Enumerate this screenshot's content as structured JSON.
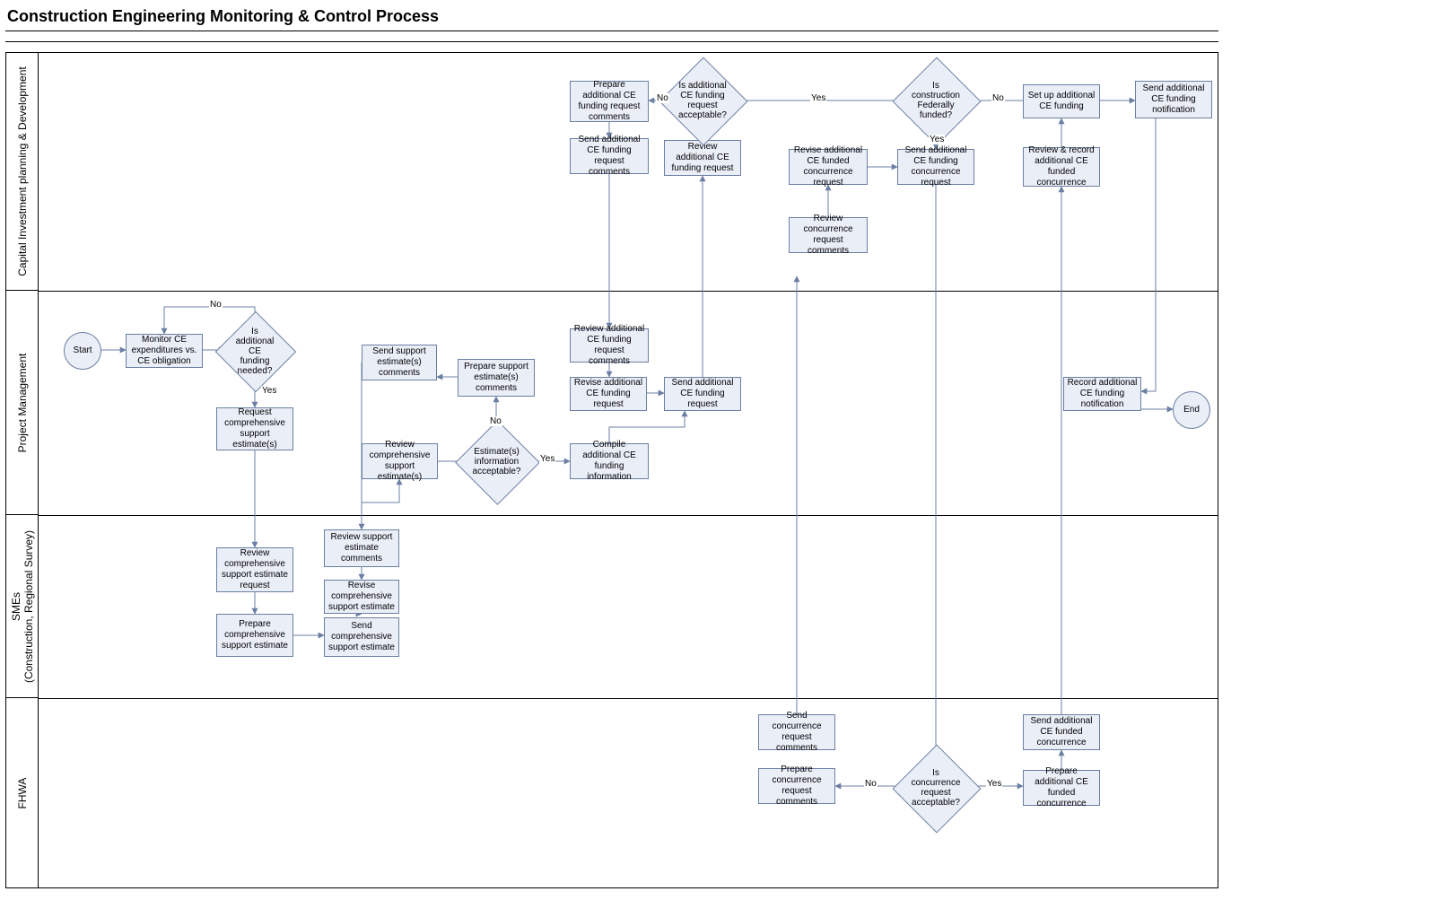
{
  "title": "Construction Engineering Monitoring & Control Process",
  "lanes": {
    "l1": "Capital Investment planning & Development",
    "l2": "Project Management",
    "l3": "SMEs\n(Construction, Regional Survey)",
    "l4": "FHWA"
  },
  "nodes": {
    "start": "Start",
    "end": "End",
    "monitor": "Monitor CE expenditures vs. CE obligation",
    "d_need": "Is additional CE funding needed?",
    "request_est": "Request comprehensive support estimate(s)",
    "review_req": "Review comprehensive support estimate request",
    "prepare_est": "Prepare comprehensive support estimate",
    "review_sec": "Review support estimate comments",
    "revise_est": "Revise comprehensive support estimate",
    "send_est": "Send comprehensive support estimate",
    "review_est": "Review comprehensive support estimate(s)",
    "d_info": "Estimate(s) information acceptable?",
    "prep_comm": "Prepare support estimate(s) comments",
    "send_comm": "Send support estimate(s) comments",
    "compile": "Compile additional CE funding information",
    "review_fc": "Review additional CE funding request comments",
    "revise_fr": "Revise additional CE funding request",
    "send_fr": "Send additional CE funding request",
    "prep_add": "Prepare additional CE funding request comments",
    "send_add": "Send additional CE funding request comments",
    "review_add": "Review additional CE funding request",
    "d_acc": "Is additional CE funding request acceptable?",
    "d_fed": "Is construction Federally funded?",
    "revise_conc": "Revise additional CE funded concurrence request",
    "send_concreq": "Send additional CE funding concurrence request",
    "review_conc_c": "Review concurrence request comments",
    "send_cc": "Send concurrence request comments",
    "prep_cc": "Prepare concurrence request comments",
    "d_conc": "Is concurrence request acceptable?",
    "prep_afc": "Prepare additional CE funded concurrence",
    "send_afc": "Send additional CE funded concurrence",
    "review_afc": "Review & record additional CE funded concurrence",
    "setup": "Set up additional CE funding",
    "send_not": "Send additional CE funding notification",
    "record_not": "Record additional CE funding notification"
  },
  "labels": {
    "no": "No",
    "yes": "Yes"
  }
}
